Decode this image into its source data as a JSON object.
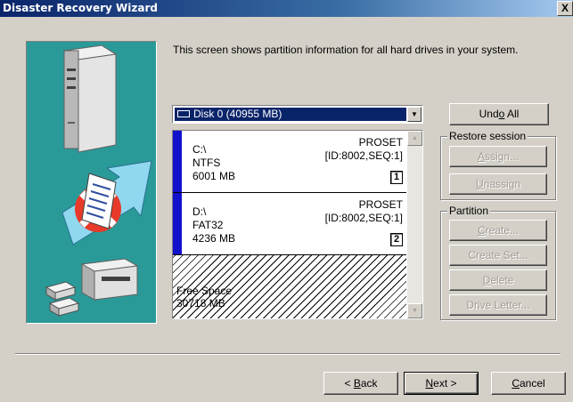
{
  "window": {
    "title": "Disaster Recovery Wizard",
    "close_glyph": "X"
  },
  "description": "This screen shows partition information for all hard drives in your system.",
  "disk_select": {
    "value": "Disk 0  (40955 MB)"
  },
  "partitions": [
    {
      "drive": "C:\\",
      "fs": "NTFS",
      "size": "6001 MB",
      "label": "PROSET",
      "id": "[ID:8002,SEQ:1]",
      "number": "1"
    },
    {
      "drive": "D:\\",
      "fs": "FAT32",
      "size": "4236 MB",
      "label": "PROSET",
      "id": "[ID:8002,SEQ:1]",
      "number": "2"
    }
  ],
  "free_space": {
    "label": "Free Space",
    "size": "30718 MB"
  },
  "buttons": {
    "undo_all": {
      "pre": "Und",
      "key": "o",
      "post": " All"
    },
    "restore_session": {
      "title": "Restore session",
      "assign": {
        "pre": "",
        "key": "A",
        "post": "ssign..."
      },
      "unassign": {
        "pre": "",
        "key": "U",
        "post": "nassign"
      }
    },
    "partition": {
      "title": "Partition",
      "create": {
        "pre": "",
        "key": "C",
        "post": "reate..."
      },
      "create_set": "Create Set...",
      "delete": {
        "pre": "",
        "key": "D",
        "post": "elete"
      },
      "drive_letter": "Drive Letter..."
    },
    "back": {
      "pre": "< ",
      "key": "B",
      "post": "ack"
    },
    "next": {
      "pre": "",
      "key": "N",
      "post": "ext >"
    },
    "cancel": {
      "pre": "",
      "key": "C",
      "post": "ancel"
    }
  },
  "colors": {
    "title_bar": "#0a246a",
    "art_bg": "#2a9a98",
    "partition_bar": "#1111cc",
    "dialog_bg": "#d4d0c8"
  }
}
